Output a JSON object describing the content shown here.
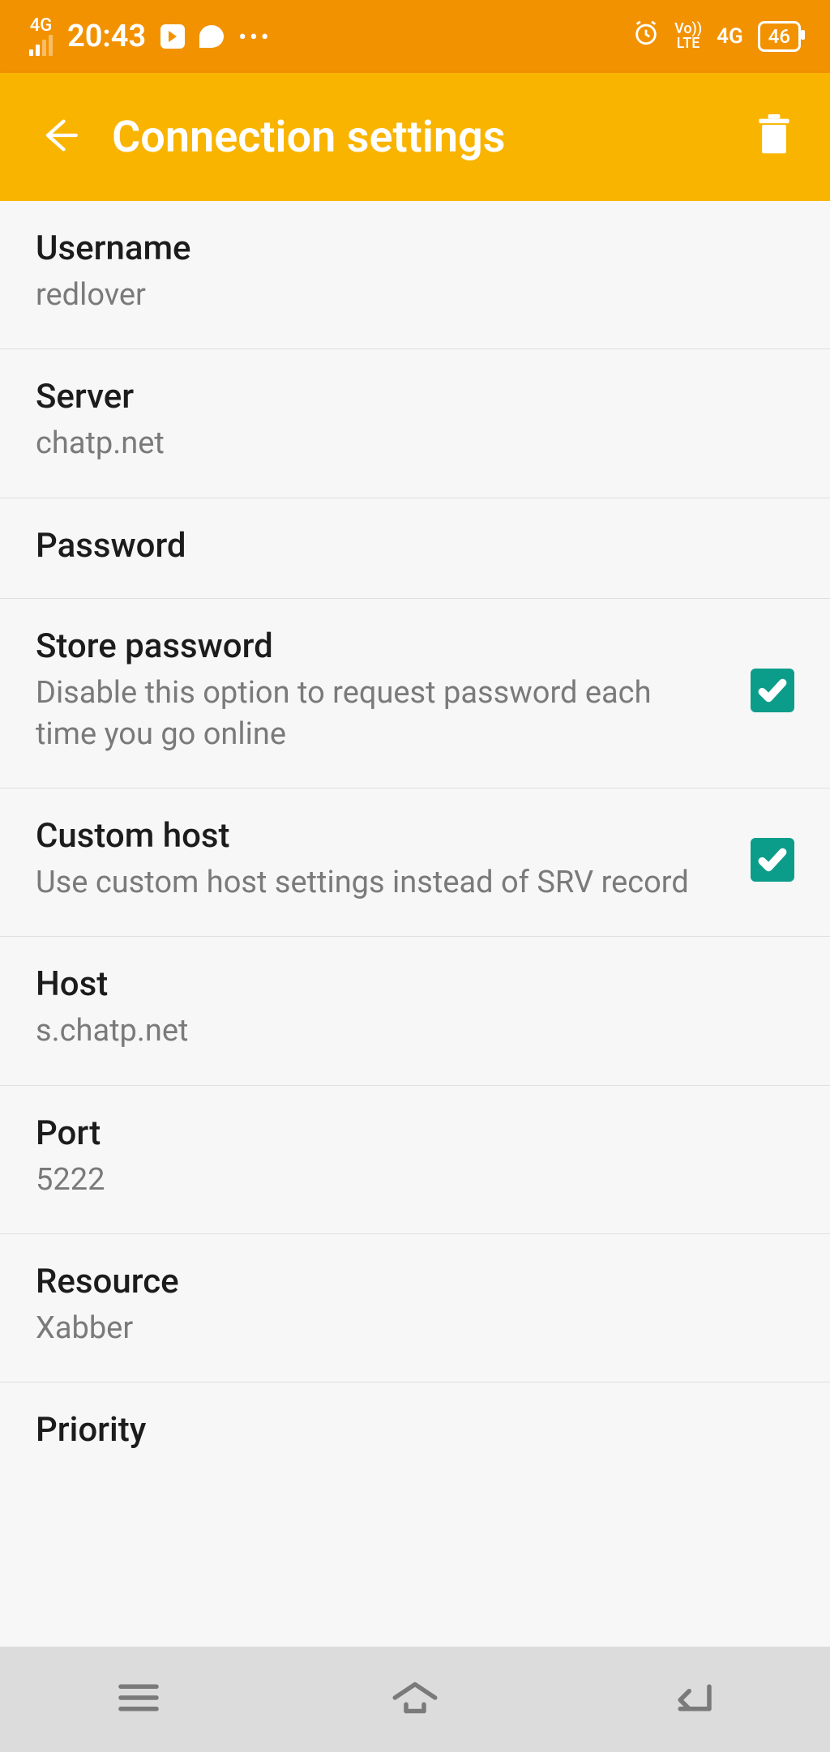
{
  "status": {
    "net_type_top": "4G",
    "time": "20:43",
    "dots": "•••",
    "volte_top": "Vo))",
    "volte_bottom": "LTE",
    "net_right": "4G",
    "battery": "46"
  },
  "appbar": {
    "title": "Connection settings"
  },
  "settings": {
    "username": {
      "title": "Username",
      "value": "redlover"
    },
    "server": {
      "title": "Server",
      "value": "chatp.net"
    },
    "password": {
      "title": "Password"
    },
    "store_password": {
      "title": "Store password",
      "desc": "Disable this option to request password each time you go online",
      "checked": true
    },
    "custom_host": {
      "title": "Custom host",
      "desc": "Use custom host settings instead of SRV record",
      "checked": true
    },
    "host": {
      "title": "Host",
      "value": "s.chatp.net"
    },
    "port": {
      "title": "Port",
      "value": "5222"
    },
    "resource": {
      "title": "Resource",
      "value": "Xabber"
    },
    "priority": {
      "title": "Priority"
    }
  }
}
